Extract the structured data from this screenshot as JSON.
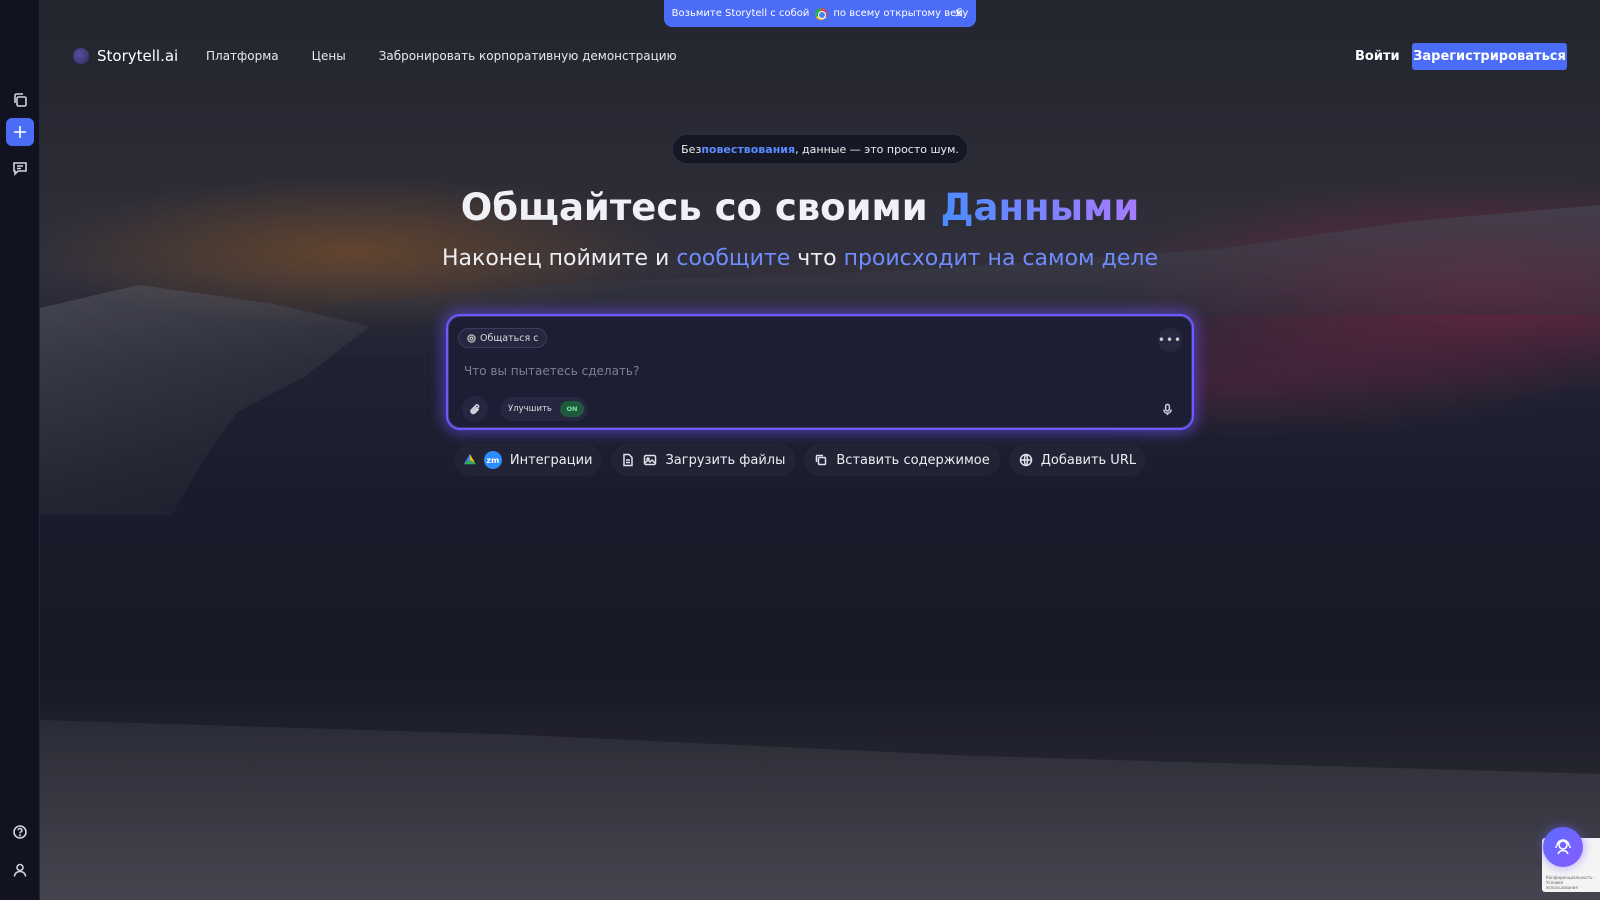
{
  "promo": {
    "text_before": "Возьмите Storytell с собой",
    "text_after": "по всему открытому вебу",
    "close": "×"
  },
  "header": {
    "logo": "Storytell.ai",
    "nav": [
      "Платформа",
      "Цены",
      "Забронировать корпоративную демонстрацию"
    ],
    "login": "Войти",
    "signup": "Зарегистрироваться"
  },
  "hero": {
    "tagline_before": "Без ",
    "tagline_highlight": "повествования",
    "tagline_after": ", данные — это просто шум.",
    "title_main": "Общайтесь со своими ",
    "title_highlight": "Данными",
    "subtitle_1": "Наконец поймите и ",
    "subtitle_hl_1": "сообщите",
    "subtitle_2": " что ",
    "subtitle_hl_2": "происходит на самом деле"
  },
  "prompt": {
    "chip": "Общаться с",
    "more": "•••",
    "placeholder": "Что вы пытаетесь сделать?",
    "improve_label": "Улучшить",
    "improve_state": "ON"
  },
  "actions": {
    "integrations": "Интеграции",
    "zoom_badge": "zm",
    "upload": "Загрузить файлы",
    "paste": "Вставить содержимое",
    "url": "Добавить URL"
  },
  "recaptcha": {
    "text": "Конфиденциальность - Условия использования"
  },
  "colors": {
    "accent": "#4a6cf7",
    "sidebar": "#111420",
    "prompt_border": "#6a5cff"
  }
}
